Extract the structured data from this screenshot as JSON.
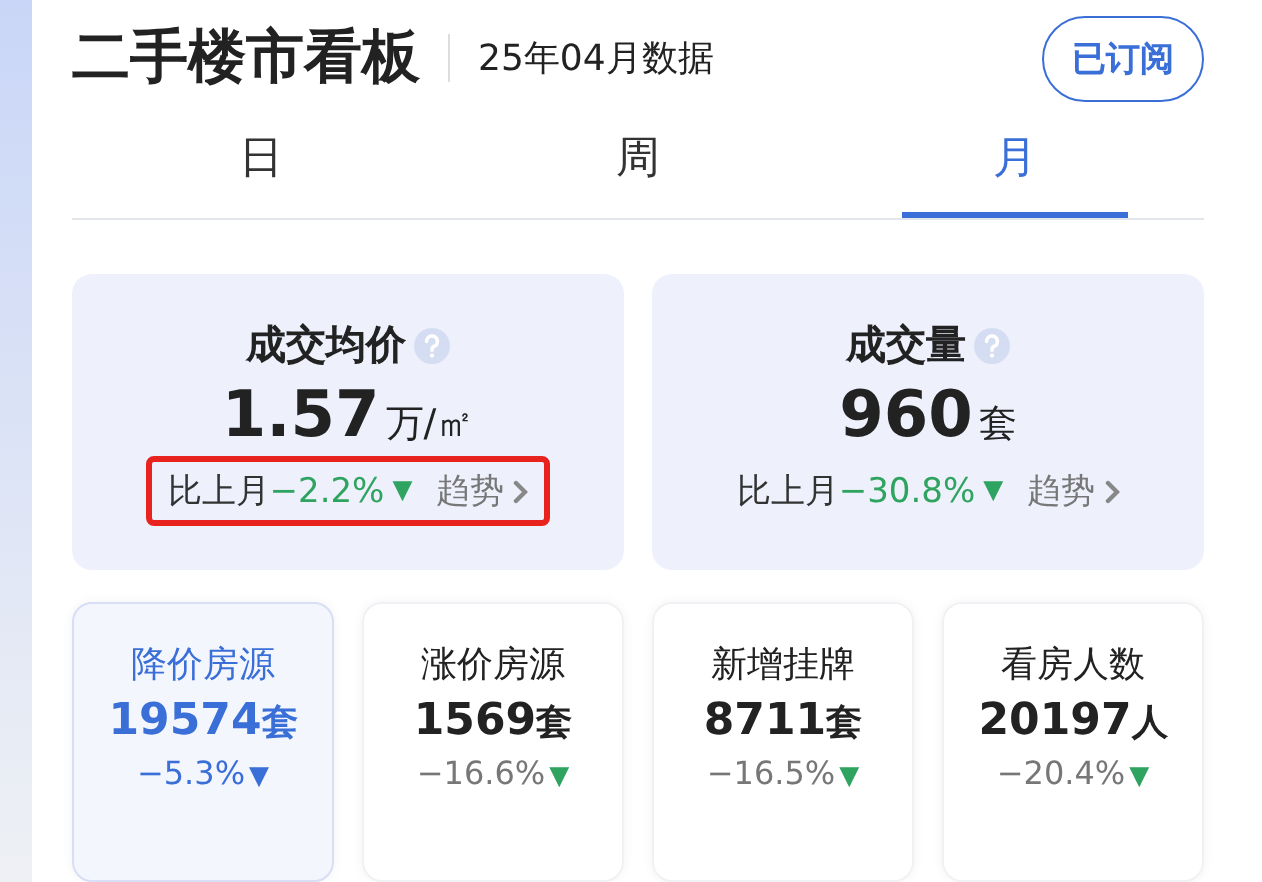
{
  "header": {
    "title": "二手楼市看板",
    "subtitle": "25年04月数据",
    "subscribe_button": "已订阅"
  },
  "tabs": [
    {
      "label": "日",
      "selected": false
    },
    {
      "label": "周",
      "selected": false
    },
    {
      "label": "月",
      "selected": true
    }
  ],
  "main_stats": [
    {
      "label": "成交均价",
      "value": "1.57",
      "unit": "万/㎡",
      "compare_label": "比上月",
      "change": "−2.2%",
      "arrow": "▼",
      "trend_link": "趋势",
      "highlighted": true
    },
    {
      "label": "成交量",
      "value": "960",
      "unit": "套",
      "compare_label": "比上月",
      "change": "−30.8%",
      "arrow": "▼",
      "trend_link": "趋势",
      "highlighted": false
    }
  ],
  "sub_stats": [
    {
      "label": "降价房源",
      "value": "19574",
      "unit": "套",
      "change": "−5.3%",
      "arrow": "▼",
      "selected": true
    },
    {
      "label": "涨价房源",
      "value": "1569",
      "unit": "套",
      "change": "−16.6%",
      "arrow": "▼",
      "selected": false
    },
    {
      "label": "新增挂牌",
      "value": "8711",
      "unit": "套",
      "change": "−16.5%",
      "arrow": "▼",
      "selected": false
    },
    {
      "label": "看房人数",
      "value": "20197",
      "unit": "人",
      "change": "−20.4%",
      "arrow": "▼",
      "selected": false
    }
  ]
}
